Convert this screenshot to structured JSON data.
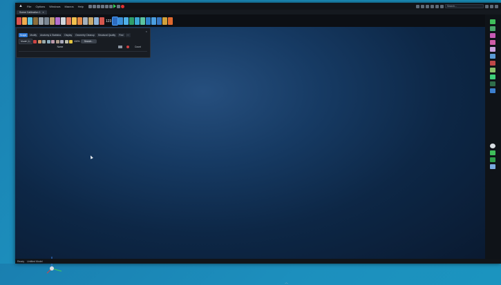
{
  "menubar": {
    "items": [
      "File",
      "Options",
      "Windows",
      "Macros",
      "Help"
    ]
  },
  "search": {
    "placeholder": "Search..."
  },
  "document_tab": {
    "label": "Scene Calibration 1",
    "close": "×"
  },
  "toolbar": {
    "counter_label": "123"
  },
  "panel": {
    "close": "×",
    "tabs": [
      "Scope",
      "Modify",
      "Anatomy & Statistics",
      "Display",
      "Geometry Cleanup",
      "Structural Quality",
      "Find",
      "› ›"
    ],
    "selector_value": "Model (1)",
    "zoom_value": "100%",
    "search_button": "Search...",
    "row3": {
      "left": "Name",
      "right": "Count"
    }
  },
  "statusbar": {
    "left": "Ready",
    "mid": "Untitled Model"
  },
  "colors": {
    "accent": "#2f7ad8",
    "record": "#e03232",
    "play": "#34d25a"
  }
}
